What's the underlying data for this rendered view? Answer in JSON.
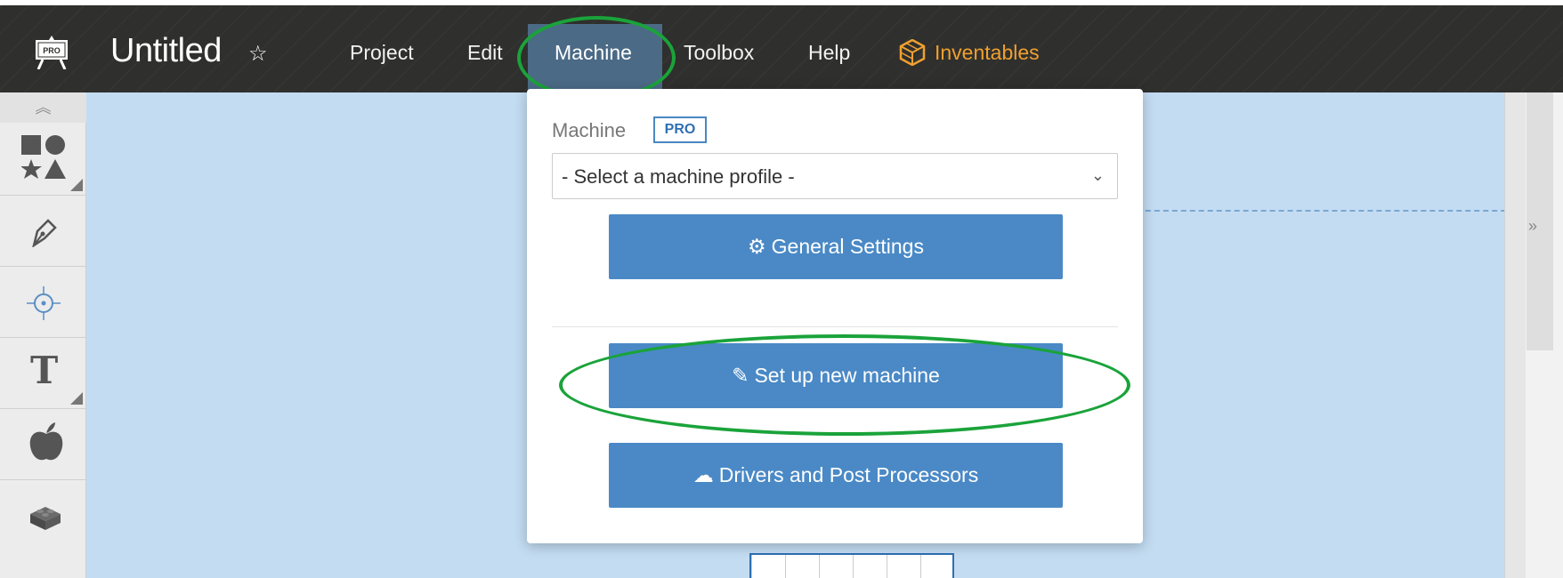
{
  "app": {
    "title": "Untitled",
    "logo_text": "PRO",
    "star_icon": "star-outline-icon"
  },
  "menu": {
    "items": [
      "Project",
      "Edit",
      "Machine",
      "Toolbox",
      "Help"
    ],
    "active": "Machine",
    "inventables": "Inventables",
    "inventables_color": "#f0a030"
  },
  "sidebar": {
    "collapse_icon": "double-chevron-up-icon",
    "tools": [
      "shapes-icon",
      "pen-icon",
      "point-icon",
      "text-icon",
      "apple-icon",
      "lego-icon"
    ],
    "text_tool_glyph": "T"
  },
  "dropdown": {
    "section_label": "Machine",
    "pro_badge": "PRO",
    "select_placeholder": "- Select a machine profile -",
    "general_settings": "General Settings",
    "setup_new_machine": "Set up new machine",
    "drivers": "Drivers and Post Processors"
  },
  "right_panel": {
    "expand_icon": "double-chevron-right-icon"
  },
  "colors": {
    "topbar": "#2f2f2d",
    "canvas": "#c3dcf2",
    "button": "#4a89c6",
    "annotation": "#1aa33a"
  }
}
